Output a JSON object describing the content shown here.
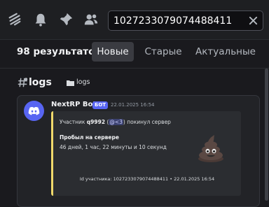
{
  "toolbar": {
    "icons": [
      "threads-icon",
      "bell-icon",
      "pin-icon",
      "members-icon"
    ]
  },
  "search": {
    "query": "1027233079074488411"
  },
  "results": {
    "count_label": "98 результатов",
    "tabs": [
      {
        "label": "Новые",
        "active": true
      },
      {
        "label": "Старые",
        "active": false
      },
      {
        "label": "Актуальные",
        "active": false
      }
    ]
  },
  "channel": {
    "name": "logs",
    "category": "logs"
  },
  "message": {
    "author": "NextRP Bot",
    "badge": "БОТ",
    "timestamp": "22.01.2025 16:54",
    "embed": {
      "accent_color": "#f0d96b",
      "prefix": "Участник ",
      "username": "q9992",
      "paren_open": " (",
      "mention": "@<3",
      "suffix": ") покинул сервер",
      "field_name": "Пробыл на сервере",
      "field_value": "46 дней, 1 час, 22 минуты и 10 секунд",
      "footer": "Id участника: 1027233079074488411 • 22.01.2025 16:54",
      "thumbnail": "poop-emoji"
    }
  },
  "colors": {
    "background": "#1a1a1e",
    "accent": "#5865f2",
    "embed_border": "#f0d96b"
  }
}
